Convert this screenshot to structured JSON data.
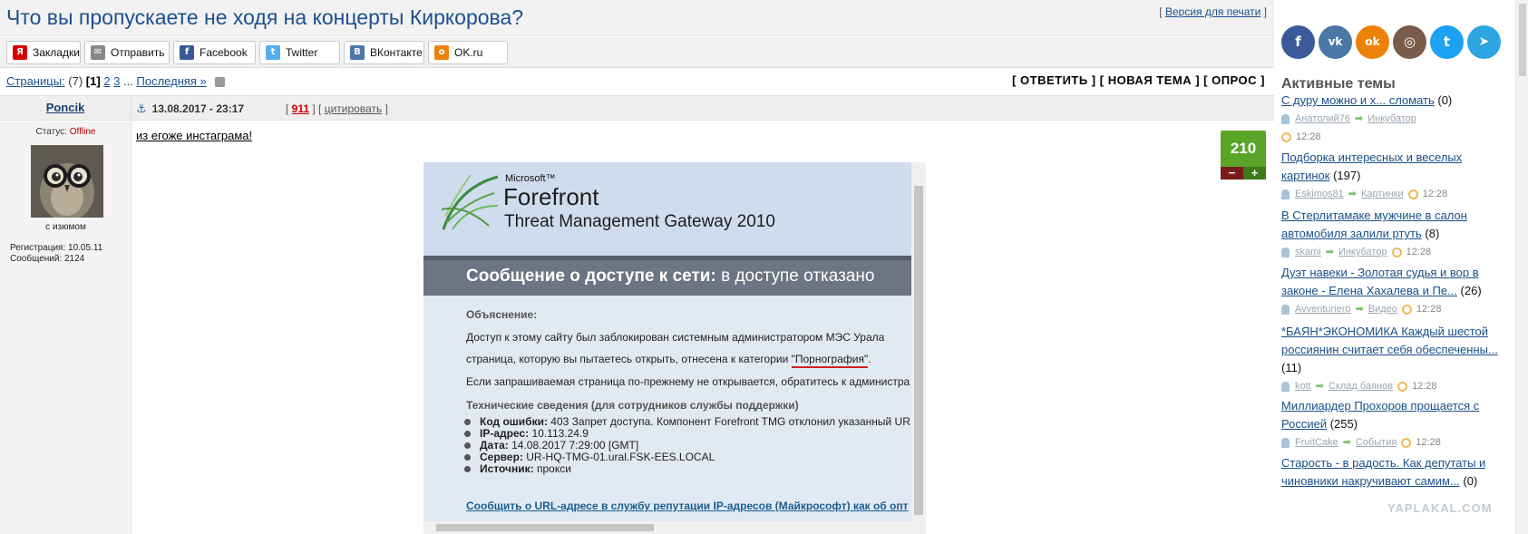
{
  "topic": {
    "title": "Что вы пропускаете не ходя на концерты Киркорова?",
    "print_prefix": "[ ",
    "print_link": "Версия для печати",
    "print_suffix": " ]"
  },
  "share_buttons": [
    {
      "label": "Закладки",
      "icon": "yandex-icon",
      "color": "#d40000",
      "glyph": "Я"
    },
    {
      "label": "Отправить",
      "icon": "mail-icon",
      "color": "#888888",
      "glyph": "✉"
    },
    {
      "label": "Facebook",
      "icon": "facebook-icon",
      "color": "#3b5998",
      "glyph": "f"
    },
    {
      "label": "Twitter",
      "icon": "twitter-icon",
      "color": "#55acee",
      "glyph": "t"
    },
    {
      "label": "ВКонтакте",
      "icon": "vk-icon",
      "color": "#4a76a8",
      "glyph": "В"
    },
    {
      "label": "OK.ru",
      "icon": "ok-icon",
      "color": "#ee8208",
      "glyph": "о"
    }
  ],
  "pager": {
    "label": "Страницы:",
    "total": "(7)",
    "current": "[1]",
    "pages": [
      "2",
      "3"
    ],
    "ellipsis": "...",
    "last": "Последняя »"
  },
  "actions": "[ ОТВЕТИТЬ ] [ НОВАЯ ТЕМА ] [ ОПРОС ]",
  "post": {
    "author": "Poncik",
    "date": "13.08.2017 - 23:17",
    "meta_open": "[ ",
    "number": "911",
    "meta_mid": " ] [ ",
    "quote": "цитировать",
    "meta_close": " ]",
    "status_label": "Статус: ",
    "status_value": "Offline",
    "avatar_caption": "с изюмом",
    "registration": "Регистрация: 10.05.11",
    "messages": "Сообщений: 2124",
    "text": "из егоже инстаграма!",
    "rating": "210",
    "rating_minus": "−",
    "rating_plus": "+"
  },
  "screenshot": {
    "brand": "Microsoft™",
    "product": "Forefront",
    "subtitle": "Threat Management Gateway 2010",
    "banner_bold": "Сообщение о доступе к сети:",
    "banner_rest": " в доступе отказано",
    "explain_head": "Объяснение:",
    "line1": "Доступ к этому сайту был заблокирован системным администратором МЭС Урала",
    "line2_prefix": "страница, которую вы пытаетесь открыть, отнесена к категории ",
    "category": "\"Порнография\"",
    "line2_suffix": ".",
    "line3": "Если запрашиваемая страница по-прежнему не открывается, обратитесь к администра",
    "tech_head": "Технические сведения (для сотрудников службы поддержки)",
    "items": [
      {
        "k": "Код ошибки:",
        "v": " 403 Запрет доступа. Компонент Forefront TMG отклонил указанный UR"
      },
      {
        "k": "IP-адрес:",
        "v": " 10.113.24.9"
      },
      {
        "k": "Дата:",
        "v": " 14.08.2017 7:29:00 [GMT]"
      },
      {
        "k": "Сервер:",
        "v": " UR-HQ-TMG-01.ural.FSK-EES.LOCAL"
      },
      {
        "k": "Источник:",
        "v": " прокси"
      }
    ],
    "report_link": "Сообщить о URL-адресе в службу репутации IP-адресов (Майкрософт) как об опт"
  },
  "sidebar": {
    "social": [
      {
        "icon": "facebook-icon",
        "glyph": "f",
        "color": "#3b5998"
      },
      {
        "icon": "vk-icon",
        "glyph": "vk",
        "color": "#4a76a8"
      },
      {
        "icon": "odnoklassniki-icon",
        "glyph": "ok",
        "color": "#ee8208"
      },
      {
        "icon": "instagram-icon",
        "glyph": "◎",
        "color": "#7a5c4a"
      },
      {
        "icon": "twitter-icon",
        "glyph": "t",
        "color": "#1da1f2"
      },
      {
        "icon": "telegram-icon",
        "glyph": "➤",
        "color": "#2ca5e0"
      }
    ],
    "title": "Активные темы",
    "topics": [
      {
        "title": "С дуру можно и х... сломать",
        "count": " (0)",
        "user": "Анатолий76",
        "section": "Инкубатор",
        "time": "12:28"
      },
      {
        "title": "Подборка интересных и веселых картинок",
        "count": " (197)",
        "user": "Eskimos81",
        "section": "Картинки",
        "time": "12:28"
      },
      {
        "title": "В Стерлитамаке мужчине в салон автомобиля залили ртуть",
        "count": " (8)",
        "user": "skami",
        "section": "Инкубатор",
        "time": "12:28"
      },
      {
        "title": "Дуэт навеки - Золотая судья и вор в законе - Елена Хахалева и Пе...",
        "count": " (26)",
        "user": "Avventuriero",
        "section": "Видео",
        "time": "12:28"
      },
      {
        "title": "*БАЯН*ЭКОНОМИКА Каждый шестой россиянин считает себя обеспеченны...",
        "count": " (11)",
        "user": "kott",
        "section": "Склад баянов",
        "time": "12:28"
      },
      {
        "title": "Миллиардер Прохоров прощается с Россией",
        "count": " (255)",
        "user": "FruitCake",
        "section": "События",
        "time": "12:28"
      },
      {
        "title": "Старость - в радость. Как депутаты и чиновники накручивают самим...",
        "count": " (0)",
        "user": "",
        "section": "",
        "time": ""
      }
    ],
    "watermark": "YAPLAKAL.COM"
  }
}
